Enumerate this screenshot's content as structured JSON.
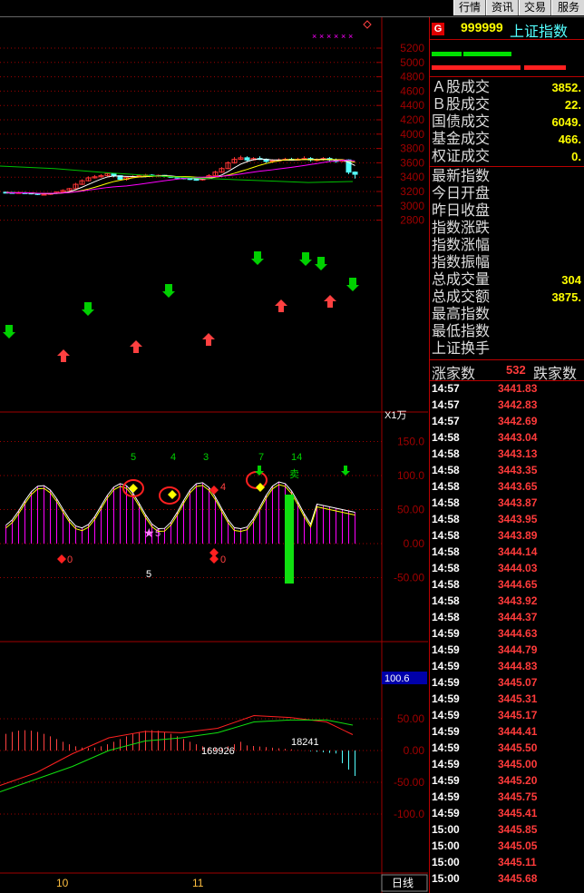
{
  "toolbar": {
    "buttons": [
      "行情",
      "资讯",
      "交易",
      "服务"
    ]
  },
  "header": {
    "badge": "G",
    "code": "999999",
    "name": "上证指数"
  },
  "turnover": [
    {
      "label": "Ａ股成交",
      "value": "3852."
    },
    {
      "label": "Ｂ股成交",
      "value": "22."
    },
    {
      "label": "国债成交",
      "value": "6049."
    },
    {
      "label": "基金成交",
      "value": "466."
    },
    {
      "label": "权证成交",
      "value": "0."
    }
  ],
  "index_stats": [
    {
      "label": "最新指数",
      "value": ""
    },
    {
      "label": "今日开盘",
      "value": ""
    },
    {
      "label": "昨日收盘",
      "value": ""
    },
    {
      "label": "指数涨跌",
      "value": ""
    },
    {
      "label": "指数涨幅",
      "value": ""
    },
    {
      "label": "指数振幅",
      "value": ""
    },
    {
      "label": "总成交量",
      "value": "304"
    },
    {
      "label": "总成交额",
      "value": "3875."
    },
    {
      "label": "最高指数",
      "value": ""
    },
    {
      "label": "最低指数",
      "value": ""
    },
    {
      "label": "上证换手",
      "value": ""
    }
  ],
  "breadth": {
    "up_label": "涨家数",
    "up_value": "532",
    "down_label": "跌家数"
  },
  "ticks": [
    {
      "t": "14:57",
      "p": "3441.83"
    },
    {
      "t": "14:57",
      "p": "3442.83"
    },
    {
      "t": "14:57",
      "p": "3442.69"
    },
    {
      "t": "14:58",
      "p": "3443.04"
    },
    {
      "t": "14:58",
      "p": "3443.13"
    },
    {
      "t": "14:58",
      "p": "3443.35"
    },
    {
      "t": "14:58",
      "p": "3443.65"
    },
    {
      "t": "14:58",
      "p": "3443.87"
    },
    {
      "t": "14:58",
      "p": "3443.95"
    },
    {
      "t": "14:58",
      "p": "3443.89"
    },
    {
      "t": "14:58",
      "p": "3444.14"
    },
    {
      "t": "14:58",
      "p": "3444.03"
    },
    {
      "t": "14:58",
      "p": "3444.65"
    },
    {
      "t": "14:58",
      "p": "3443.92"
    },
    {
      "t": "14:58",
      "p": "3444.37"
    },
    {
      "t": "14:59",
      "p": "3444.63"
    },
    {
      "t": "14:59",
      "p": "3444.79"
    },
    {
      "t": "14:59",
      "p": "3444.83"
    },
    {
      "t": "14:59",
      "p": "3445.07"
    },
    {
      "t": "14:59",
      "p": "3445.31"
    },
    {
      "t": "14:59",
      "p": "3445.17"
    },
    {
      "t": "14:59",
      "p": "3444.41"
    },
    {
      "t": "14:59",
      "p": "3445.50"
    },
    {
      "t": "14:59",
      "p": "3445.00"
    },
    {
      "t": "14:59",
      "p": "3445.20"
    },
    {
      "t": "14:59",
      "p": "3445.75"
    },
    {
      "t": "14:59",
      "p": "3445.41"
    },
    {
      "t": "15:00",
      "p": "3445.85"
    },
    {
      "t": "15:00",
      "p": "3445.05"
    },
    {
      "t": "15:00",
      "p": "3445.11"
    },
    {
      "t": "15:00",
      "p": "3445.68"
    }
  ],
  "chart": {
    "price_axis": [
      "5200",
      "5000",
      "4800",
      "4600",
      "4400",
      "4200",
      "4000",
      "3800",
      "3600",
      "3400",
      "3200",
      "3000",
      "2800"
    ],
    "unit_label": "X1万",
    "mid_axis": [
      "150.0",
      "100.0",
      "50.00",
      "0.00",
      "-50.00"
    ],
    "macd_axis": [
      "50.00",
      "0.00",
      "-50.00",
      "-100.0"
    ],
    "macd_tag": "100.6",
    "period_label": "日线",
    "date_labels": [
      "10",
      "11"
    ],
    "mid_annotations": [
      "5",
      "4",
      "3",
      "7",
      "14",
      "卖",
      "5",
      "0",
      "4",
      "0",
      "5"
    ],
    "macd_annotations": [
      "169926",
      "18241"
    ],
    "colors": {
      "up": "#ff3333",
      "down": "#54ffff",
      "ma5": "#ffffff",
      "ma10": "#ffff00",
      "ma20": "#ff00ff",
      "ma60": "#00c000",
      "grid": "#a00000"
    }
  }
}
